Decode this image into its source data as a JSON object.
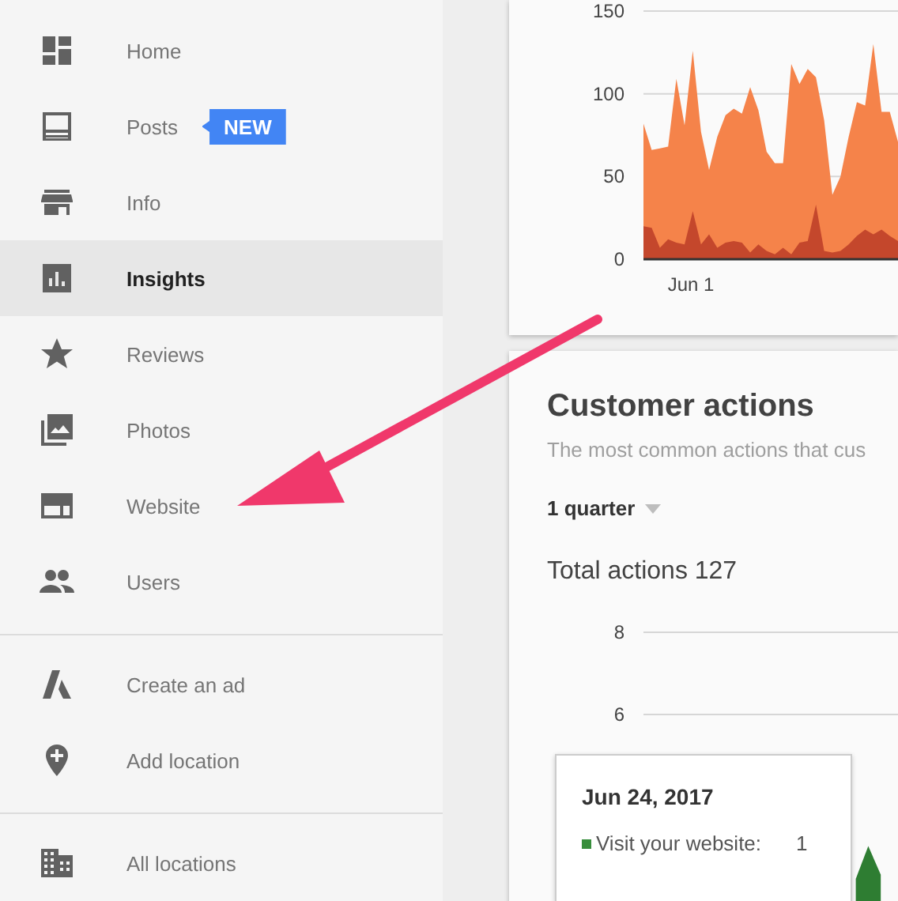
{
  "sidebar": {
    "sections": [
      [
        {
          "label": "Home",
          "selected": false
        },
        {
          "label": "Posts",
          "selected": false,
          "badge": "NEW"
        },
        {
          "label": "Info",
          "selected": false
        },
        {
          "label": "Insights",
          "selected": true
        },
        {
          "label": "Reviews",
          "selected": false
        },
        {
          "label": "Photos",
          "selected": false
        },
        {
          "label": "Website",
          "selected": false
        },
        {
          "label": "Users",
          "selected": false
        }
      ],
      [
        {
          "label": "Create an ad",
          "selected": false
        },
        {
          "label": "Add location",
          "selected": false
        }
      ],
      [
        {
          "label": "All locations",
          "selected": false
        }
      ]
    ]
  },
  "views_card": {
    "date_label": "Jun 1",
    "chart_data": {
      "type": "area",
      "stacked": false,
      "yticks": [
        0,
        50,
        100,
        150
      ],
      "ylim": [
        0,
        150
      ],
      "series": [
        {
          "color": "#f5834a",
          "values": [
            82,
            66,
            67,
            68,
            109,
            81,
            126,
            77,
            54,
            74,
            87,
            91,
            88,
            104,
            90,
            65,
            58,
            58,
            118,
            106,
            115,
            110,
            84,
            39,
            50,
            74,
            95,
            93,
            130,
            89,
            89,
            71
          ]
        },
        {
          "color": "#c4472c",
          "values": [
            20,
            19,
            7,
            12,
            10,
            9,
            29,
            9,
            15,
            7,
            10,
            11,
            10,
            4,
            9,
            5,
            3,
            7,
            3,
            10,
            11,
            33,
            5,
            4,
            5,
            9,
            14,
            18,
            15,
            18,
            14,
            11
          ]
        }
      ]
    }
  },
  "actions_card": {
    "title": "Customer actions",
    "subtitle": "The most common actions that cus",
    "period": "1 quarter",
    "total": "Total actions 127",
    "chart_data": {
      "type": "area",
      "yticks": [
        6,
        8
      ],
      "ylim": [
        0,
        8
      ],
      "series": [
        {
          "color": "#2e7d32",
          "values": [
            null,
            null,
            null,
            null,
            null,
            null,
            null,
            null,
            null,
            null,
            null,
            null,
            null,
            null,
            null,
            null,
            null,
            2.0,
            2.8,
            2.1,
            null
          ]
        }
      ]
    },
    "tooltip": {
      "date": "Jun 24, 2017",
      "rows": [
        {
          "label": "Visit your website:",
          "value": "1",
          "color": "#388e3c"
        }
      ]
    }
  }
}
